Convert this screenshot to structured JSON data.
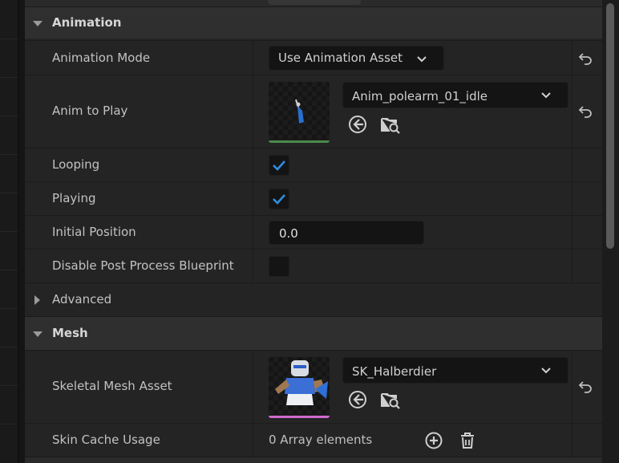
{
  "categories": {
    "animation": {
      "title": "Animation"
    },
    "advanced": {
      "title": "Advanced"
    },
    "mesh": {
      "title": "Mesh"
    }
  },
  "properties": {
    "animation_mode": {
      "label": "Animation Mode",
      "value": "Use Animation Asset"
    },
    "anim_to_play": {
      "label": "Anim to Play",
      "value": "Anim_polearm_01_idle",
      "thumbnail_bar_color": "#4a8a4a"
    },
    "looping": {
      "label": "Looping",
      "checked": true
    },
    "playing": {
      "label": "Playing",
      "checked": true
    },
    "initial_position": {
      "label": "Initial Position",
      "value": "0.0"
    },
    "disable_post_process": {
      "label": "Disable Post Process Blueprint",
      "checked": false
    },
    "skeletal_mesh_asset": {
      "label": "Skeletal Mesh Asset",
      "value": "SK_Halberdier",
      "thumbnail_bar_color": "#d06ad0"
    },
    "skin_cache_usage": {
      "label": "Skin Cache Usage",
      "value": "0 Array elements"
    }
  },
  "colors": {
    "accent": "#2f8fe0",
    "panel_bg": "#242424",
    "category_bg": "#2f2f2f",
    "field_bg": "#141414"
  },
  "icons": {
    "reset": "reset-arrow-icon",
    "browse_to": "arrow-left-circle-icon",
    "find": "folder-search-icon",
    "add": "plus-circle-icon",
    "remove": "trash-icon"
  }
}
